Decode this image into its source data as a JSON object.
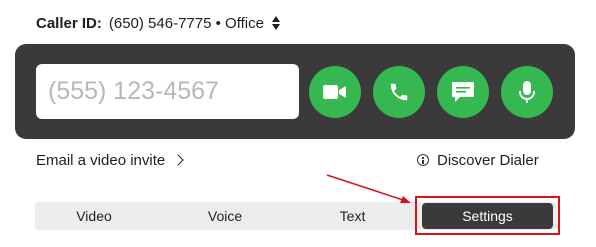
{
  "caller_id": {
    "label": "Caller ID:",
    "value": "(650) 546-7775 • Office",
    "selector_icon": "sort-arrows-icon"
  },
  "dialer": {
    "phone_placeholder": "(555) 123-4567",
    "phone_value": "",
    "actions": [
      {
        "name": "video-call-button",
        "icon": "video-camera-icon"
      },
      {
        "name": "voice-call-button",
        "icon": "phone-icon"
      },
      {
        "name": "text-message-button",
        "icon": "message-icon"
      },
      {
        "name": "microphone-button",
        "icon": "microphone-icon"
      }
    ],
    "panel_color": "#3a3a3a",
    "action_color": "#35b84f"
  },
  "links": {
    "email_invite": "Email a video invite",
    "discover_dialer": "Discover Dialer"
  },
  "tabs": [
    {
      "label": "Video",
      "active": false
    },
    {
      "label": "Voice",
      "active": false
    },
    {
      "label": "Text",
      "active": false
    },
    {
      "label": "Settings",
      "active": true
    }
  ],
  "annotation": {
    "highlight_color": "#d9111a"
  }
}
